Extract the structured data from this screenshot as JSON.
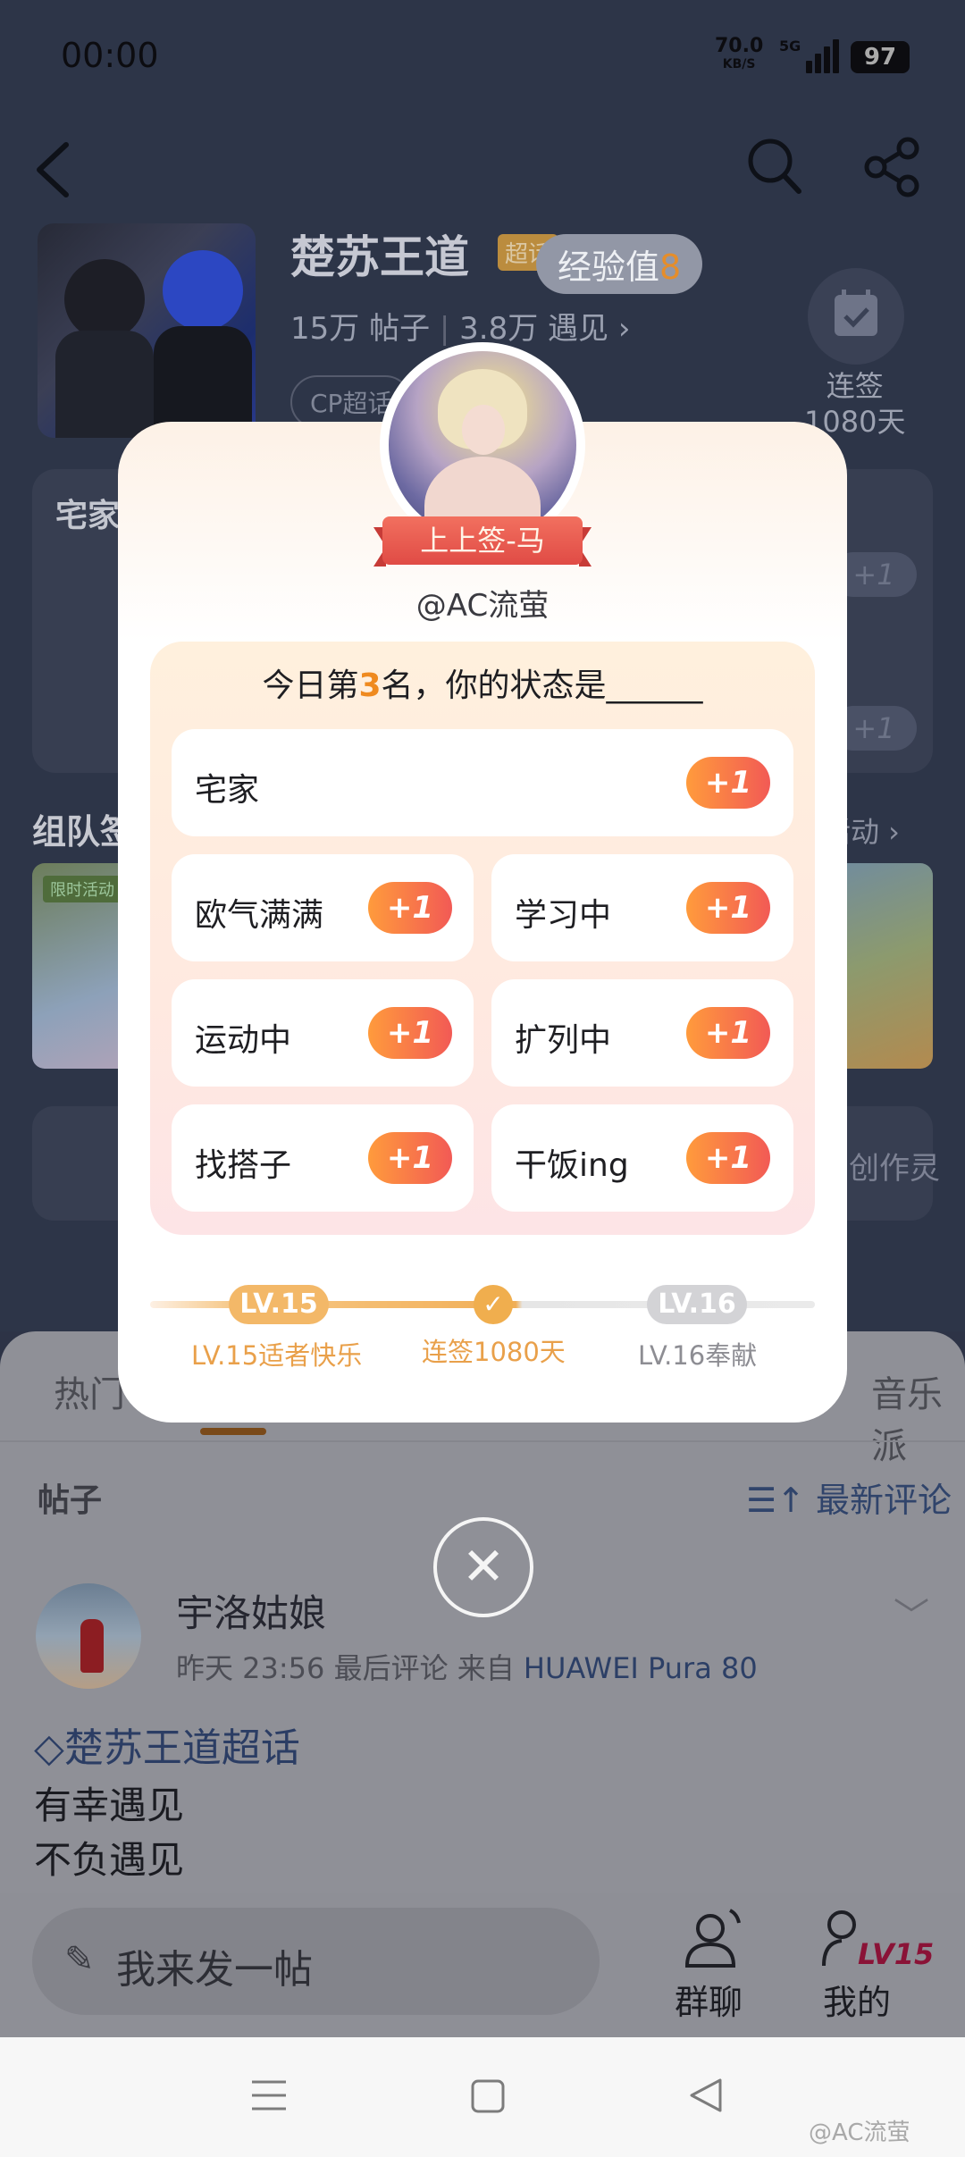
{
  "status_bar": {
    "time": "00:00",
    "speed_value": "70.0",
    "speed_unit": "KB/S",
    "network": "5G",
    "battery": "97"
  },
  "header": {
    "back_icon": "chevron-left-icon",
    "search_icon": "search-icon",
    "share_icon": "share-icon",
    "title": "楚苏王道",
    "super_tag": "超话",
    "stats_posts": "15万 帖子",
    "stats_meet": "3.8万 遇见 ›",
    "cp_tag": "CP超话",
    "checkin_label_1": "连签",
    "checkin_label_2": "1080天"
  },
  "background": {
    "card_title": "宅家",
    "plus": "+1",
    "section_title": "组队签",
    "section_more": "活动 ›",
    "banner_tag": "限时活动",
    "tools_text": "创作灵"
  },
  "exp_pill": {
    "label": "经验值",
    "value": "8"
  },
  "modal": {
    "ribbon": "上上签-马",
    "handle": "@AC流萤",
    "title_prefix": "今日第",
    "rank": "3",
    "title_suffix": "名，你的状态是______",
    "options": [
      {
        "label": "宅家",
        "plus": "+1"
      },
      {
        "label": "欧气满满",
        "plus": "+1"
      },
      {
        "label": "学习中",
        "plus": "+1"
      },
      {
        "label": "运动中",
        "plus": "+1"
      },
      {
        "label": "扩列中",
        "plus": "+1"
      },
      {
        "label": "找搭子",
        "plus": "+1"
      },
      {
        "label": "干饭ing",
        "plus": "+1"
      }
    ],
    "levels": {
      "current": "LV.15",
      "next": "LV.16",
      "current_caption": "LV.15适者快乐",
      "streak_caption": "连签1080天",
      "next_caption": "LV.16奉献"
    },
    "close_icon": "close-icon"
  },
  "sheet": {
    "tab_hot": "热门",
    "tab_music": "音乐派",
    "posts_heading": "帖子",
    "sort_label": "最新评论",
    "post": {
      "user": "宇洛姑娘",
      "meta": "昨天 23:56 最后评论   来自",
      "device": "HUAWEI Pura 80",
      "topic": "楚苏王道超话",
      "line1": "有幸遇见",
      "line2": "不负遇见"
    },
    "composer_placeholder": "我来发一帖",
    "group_chat": "群聊",
    "mine": "我的",
    "level_badge": "LV15"
  },
  "navbar": {
    "menu_icon": "menu-icon",
    "home_icon": "home-square-icon",
    "back_icon": "back-triangle-icon",
    "watermark": "@AC流萤"
  }
}
